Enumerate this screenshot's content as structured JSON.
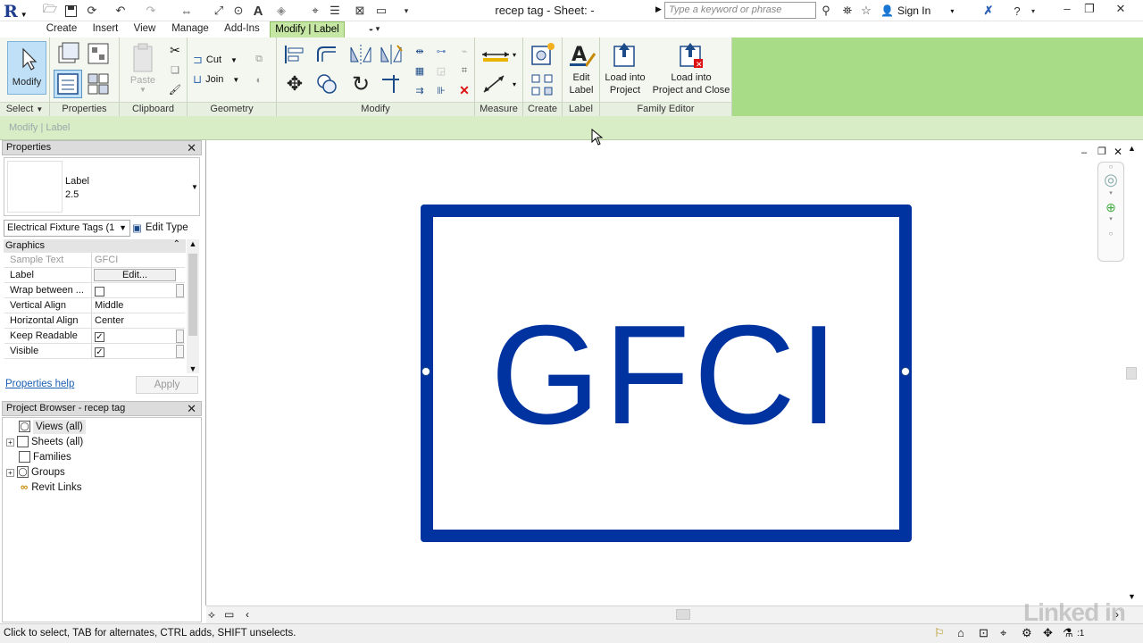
{
  "app": {
    "logo": "R",
    "document_title": "recep tag - Sheet:  -",
    "search_placeholder": "Type a keyword or phrase",
    "sign_in": "Sign In"
  },
  "tabs": [
    "Create",
    "Insert",
    "View",
    "Manage",
    "Add-Ins",
    "Modify | Label"
  ],
  "active_tab": "Modify | Label",
  "ribbon": {
    "select": {
      "label": "Select",
      "modify_label": "Modify"
    },
    "properties": {
      "label": "Properties"
    },
    "clipboard": {
      "label": "Clipboard",
      "paste": "Paste"
    },
    "geometry": {
      "label": "Geometry",
      "cut": "Cut",
      "join": "Join"
    },
    "modify": {
      "label": "Modify"
    },
    "measure": {
      "label": "Measure"
    },
    "create": {
      "label": "Create"
    },
    "label_panel": {
      "label": "Label",
      "edit_label": "Edit\nLabel"
    },
    "family_editor": {
      "label": "Family Editor",
      "load_into_project": "Load into\nProject",
      "load_close": "Load into\nProject and Close"
    }
  },
  "context_bar": {
    "text": "Modify | Label"
  },
  "properties_panel": {
    "title": "Properties",
    "type_name": "Label",
    "type_value": "2.5",
    "filter": "Electrical Fixture Tags (1",
    "edit_type": "Edit Type",
    "section": "Graphics",
    "rows": [
      {
        "name": "Sample Text",
        "value": "GFCI",
        "kind": "text",
        "disabled": true
      },
      {
        "name": "Label",
        "value": "Edit...",
        "kind": "button"
      },
      {
        "name": "Wrap between ...",
        "value": "",
        "kind": "checkbox",
        "checked": false
      },
      {
        "name": "Vertical Align",
        "value": "Middle",
        "kind": "text"
      },
      {
        "name": "Horizontal Align",
        "value": "Center",
        "kind": "text"
      },
      {
        "name": "Keep Readable",
        "value": "",
        "kind": "checkbox",
        "checked": true
      },
      {
        "name": "Visible",
        "value": "",
        "kind": "checkbox",
        "checked": true
      }
    ],
    "help_link": "Properties help",
    "apply": "Apply"
  },
  "project_browser": {
    "title": "Project Browser - recep tag",
    "items": [
      "Views (all)",
      "Sheets (all)",
      "Families",
      "Groups",
      "Revit Links"
    ]
  },
  "canvas": {
    "tag_text": "GFCI",
    "tag_color": "#0033a0"
  },
  "status_bar": {
    "text": "Click to select, TAB for alternates, CTRL adds, SHIFT unselects.",
    "filter_count": ":1"
  },
  "watermark": "Linked in"
}
